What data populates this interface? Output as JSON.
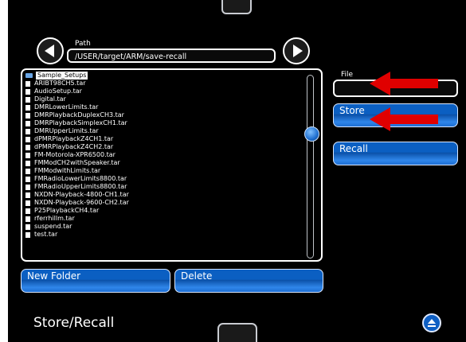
{
  "path": {
    "label": "Path",
    "value": "/USER/target/ARM/save-recall"
  },
  "files": [
    {
      "name": "Sample_Setups",
      "type": "folder",
      "selected": true
    },
    {
      "name": "ARIBT98CH5.tar",
      "type": "file"
    },
    {
      "name": "AudioSetup.tar",
      "type": "file"
    },
    {
      "name": "Digital.tar",
      "type": "file"
    },
    {
      "name": "DMRLowerLimits.tar",
      "type": "file"
    },
    {
      "name": "DMRPlaybackDuplexCH3.tar",
      "type": "file"
    },
    {
      "name": "DMRPlaybackSimplexCH1.tar",
      "type": "file"
    },
    {
      "name": "DMRUpperLimits.tar",
      "type": "file"
    },
    {
      "name": "dPMRPlaybackZ4CH1.tar",
      "type": "file"
    },
    {
      "name": "dPMRPlaybackZ4CH2.tar",
      "type": "file"
    },
    {
      "name": "FM-Motorola-XPR6500.tar",
      "type": "file"
    },
    {
      "name": "FMModCH2withSpeaker.tar",
      "type": "file"
    },
    {
      "name": "FMModwithLimits.tar",
      "type": "file"
    },
    {
      "name": "FMRadioLowerLimits8800.tar",
      "type": "file"
    },
    {
      "name": "FMRadioUpperLimits8800.tar",
      "type": "file"
    },
    {
      "name": "NXDN-Playback-4800-CH1.tar",
      "type": "file"
    },
    {
      "name": "NXDN-Playback-9600-CH2.tar",
      "type": "file"
    },
    {
      "name": "P25PlaybackCH4.tar",
      "type": "file"
    },
    {
      "name": "rferrhillm.tar",
      "type": "file"
    },
    {
      "name": "suspend.tar",
      "type": "file"
    },
    {
      "name": "test.tar",
      "type": "file"
    }
  ],
  "buttons": {
    "new_folder": "New Folder",
    "delete": "Delete",
    "store": "Store",
    "recall": "Recall"
  },
  "file": {
    "label": "File",
    "value": ""
  },
  "title": "Store/Recall",
  "colors": {
    "accent": "#0b5fc2",
    "annotation": "#e00000",
    "background": "#000000"
  }
}
